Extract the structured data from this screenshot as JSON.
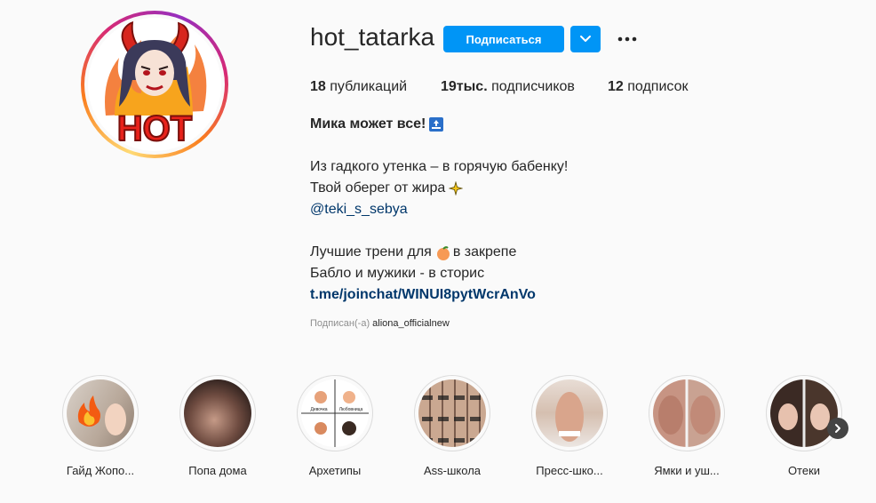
{
  "profile": {
    "username": "hot_tatarka",
    "follow_label": "Подписаться",
    "avatar_logo_text": "HOT"
  },
  "stats": {
    "posts_count": "18",
    "posts_label": " публикаций",
    "followers_count": "19тыс.",
    "followers_label": " подписчиков",
    "following_count": "12",
    "following_label": " подписок"
  },
  "bio": {
    "name": "Мика может все!",
    "line1": "Из гадкого утенка – в горячую бабенку!",
    "line2": "Твой оберег от жира",
    "mention": "@teki_s_sebya",
    "line3_a": "Лучшие трени для",
    "line3_b": "в закрепе",
    "line4": "Бабло и мужики - в сторис",
    "link": "t.me/joinchat/WINUI8pytWcrAnVo"
  },
  "followed_by": {
    "label": "Подписан(-а)",
    "account": "aliona_officialnew"
  },
  "highlights": [
    {
      "label": "Гайд Жопо..."
    },
    {
      "label": "Попа дома"
    },
    {
      "label": "Архетипы",
      "tiles": [
        "Девочка",
        "Любовница"
      ]
    },
    {
      "label": "Ass-школа"
    },
    {
      "label": "Пресс-шко..."
    },
    {
      "label": "Ямки и уш..."
    },
    {
      "label": "Отеки"
    }
  ],
  "colors": {
    "accent": "#0095f6",
    "link": "#00376b",
    "muted": "#8e8e8e"
  },
  "icons": {
    "dropdown": "chevron-down-icon",
    "more": "more-dots-icon",
    "next": "chevron-right-icon",
    "top_emoji": "top-emoji-icon",
    "sparkles_emoji": "sparkles-emoji-icon",
    "peach_emoji": "peach-emoji-icon",
    "fire_emoji": "fire-emoji-icon"
  }
}
